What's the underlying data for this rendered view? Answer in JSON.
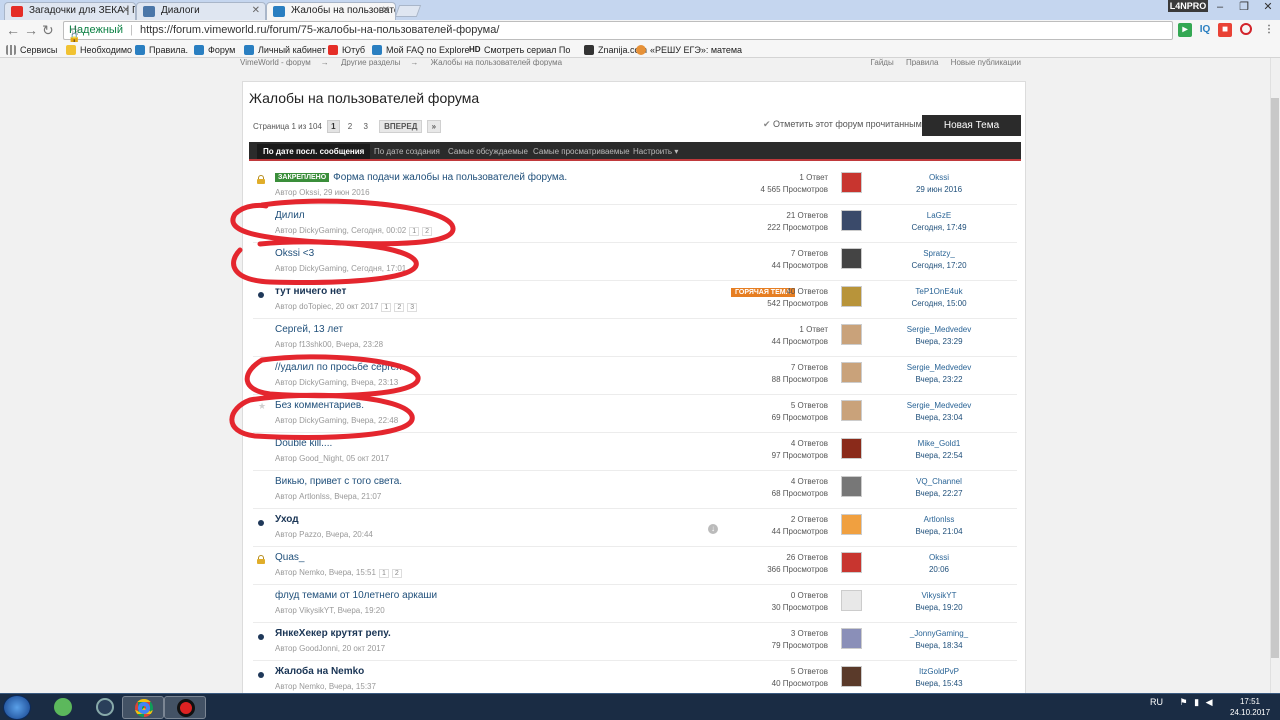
{
  "browser": {
    "tabs": [
      {
        "title": "Загадочки для ЗЕКА | П",
        "icon": "youtube-icon",
        "color": "#e52d27"
      },
      {
        "title": "Диалоги",
        "icon": "vk-icon",
        "color": "#4a76a8"
      },
      {
        "title": "Жалобы на пользовате",
        "icon": "vimeworld-icon",
        "color": "#2a7fc1",
        "active": true
      }
    ],
    "profile_badge": "L4NPRO",
    "address": {
      "secure_label": "Надежный",
      "url": "https://forum.vimeworld.ru/forum/75-жалобы-на-пользователей-форума/"
    },
    "extensions": [
      "ext-green-icon",
      "IQ",
      "ext-red-icon",
      "opera-icon"
    ],
    "bookmarks": [
      {
        "label": "Сервисы",
        "icon": "apps-icon",
        "color": "#888"
      },
      {
        "label": "Необходимо",
        "icon": "folder-icon",
        "color": "#f1c232"
      },
      {
        "label": "Правила.",
        "icon": "vimeworld-icon",
        "color": "#2a7fc1"
      },
      {
        "label": "Форум",
        "icon": "vimeworld-icon",
        "color": "#2a7fc1"
      },
      {
        "label": "Личный кабинет",
        "icon": "vimeworld-icon",
        "color": "#2a7fc1"
      },
      {
        "label": "Ютуб",
        "icon": "youtube-icon",
        "color": "#e52d27"
      },
      {
        "label": "Мой FAQ по Explore",
        "icon": "vimeworld-icon",
        "color": "#2a7fc1"
      },
      {
        "label": "Смотреть сериал По",
        "icon": "hd-icon",
        "color": "#222"
      },
      {
        "label": "Znanija.com",
        "icon": "znanija-icon",
        "color": "#333"
      },
      {
        "label": "«РЕШУ ЕГЭ»: матема",
        "icon": "reshu-ege-icon",
        "color": "#e69138"
      }
    ]
  },
  "forum": {
    "breadcrumb": [
      "VimeWorld - форум",
      "Другие разделы",
      "Жалобы на пользователей форума"
    ],
    "top_links": [
      "Гайды",
      "Правила",
      "Новые публикации"
    ],
    "title": "Жалобы на пользователей форума",
    "pager": {
      "label": "Страница 1 из 104",
      "pages": [
        "1",
        "2",
        "3"
      ],
      "next": "ВПЕРЕД",
      "next_arrow": "»"
    },
    "mark_read": "Отметить этот форум прочитанным",
    "new_topic": "Новая Тема",
    "sort_tabs": [
      "По дате посл. сообщения",
      "По дате создания",
      "Самые обсуждаемые",
      "Самые просматриваемые",
      "Настроить"
    ],
    "pinned_label": "ЗАКРЕПЛЕНО",
    "hot_label": "ГОРЯЧАЯ ТЕМА",
    "topics": [
      {
        "status": "locked",
        "pinned": true,
        "title": "Форма подачи жалобы на пользователей форума.",
        "meta": "Автор Okssi, 29 июн 2016",
        "pages": [],
        "replies": "1 Ответ",
        "views": "4 565 Просмотров",
        "last_user": "Okssi",
        "last_date": "29 июн 2016",
        "avatar_color": "#c8352f"
      },
      {
        "status": "read",
        "title": "Дилил",
        "meta": "Автор DickyGaming, Сегодня, 00:02",
        "pages": [
          "1",
          "2"
        ],
        "replies": "21 Ответов",
        "views": "222 Просмотров",
        "last_user": "LaGzE",
        "last_date": "Сегодня, 17:49",
        "avatar_color": "#3a4a6a"
      },
      {
        "status": "read",
        "title": "Okssi <3",
        "meta": "Автор DickyGaming, Сегодня, 17:01",
        "pages": [],
        "replies": "7 Ответов",
        "views": "44 Просмотров",
        "last_user": "Spratzy_",
        "last_date": "Сегодня, 17:20",
        "avatar_color": "#444"
      },
      {
        "status": "unread",
        "hot": true,
        "title": "тут ничего нет",
        "meta": "Автор doTopiec, 20 окт 2017",
        "pages": [
          "1",
          "2",
          "3"
        ],
        "replies": "40 Ответов",
        "views": "542 Просмотров",
        "last_user": "TeP1OnE4uk",
        "last_date": "Сегодня, 15:00",
        "avatar_color": "#b8943a"
      },
      {
        "status": "read",
        "title": "Сергей, 13 лет",
        "meta": "Автор f13shk00, Вчера, 23:28",
        "pages": [],
        "replies": "1 Ответ",
        "views": "44 Просмотров",
        "last_user": "Sergie_Medvedev",
        "last_date": "Вчера, 23:29",
        "avatar_color": "#c9a27a"
      },
      {
        "status": "read",
        "title": "//удалил по просьбе сергея",
        "meta": "Автор DickyGaming, Вчера, 23:13",
        "pages": [],
        "replies": "7 Ответов",
        "views": "88 Просмотров",
        "last_user": "Sergie_Medvedev",
        "last_date": "Вчера, 23:22",
        "avatar_color": "#c9a27a"
      },
      {
        "status": "star",
        "title": "Без комментариев.",
        "meta": "Автор DickyGaming, Вчера, 22:48",
        "pages": [],
        "replies": "5 Ответов",
        "views": "69 Просмотров",
        "last_user": "Sergie_Medvedev",
        "last_date": "Вчера, 23:04",
        "avatar_color": "#c9a27a"
      },
      {
        "status": "read",
        "title": "Double kill....",
        "meta": "Автор Good_Night, 05 окт 2017",
        "pages": [],
        "replies": "4 Ответов",
        "views": "97 Просмотров",
        "last_user": "Mike_Gold1",
        "last_date": "Вчера, 22:54",
        "avatar_color": "#8a2a1a"
      },
      {
        "status": "read",
        "title": "Викью, привет с того света.",
        "meta": "Автор Artlonlss, Вчера, 21:07",
        "pages": [],
        "replies": "4 Ответов",
        "views": "68 Просмотров",
        "last_user": "VQ_Channel",
        "last_date": "Вчера, 22:27",
        "avatar_color": "#777"
      },
      {
        "status": "unread",
        "download": true,
        "title": "Уход",
        "meta": "Автор Pazzo, Вчера, 20:44",
        "pages": [],
        "replies": "2 Ответов",
        "views": "44 Просмотров",
        "last_user": "Artlonlss",
        "last_date": "Вчера, 21:04",
        "avatar_color": "#f0a040"
      },
      {
        "status": "locked",
        "title": "Quas_",
        "meta": "Автор Nemko, Вчера, 15:51",
        "pages": [
          "1",
          "2"
        ],
        "replies": "26 Ответов",
        "views": "366 Просмотров",
        "last_user": "Okssi",
        "last_date": "20:06",
        "avatar_color": "#c8352f"
      },
      {
        "status": "read",
        "title": "флуд темами от 10летнего аркаши",
        "meta": "Автор VikysikYT, Вчера, 19:20",
        "pages": [],
        "replies": "0 Ответов",
        "views": "30 Просмотров",
        "last_user": "VikysikYT",
        "last_date": "Вчера, 19:20",
        "avatar_color": "#e8e8e8"
      },
      {
        "status": "unread",
        "title": "ЯнкеХекер крутят репу.",
        "meta": "Автор GoodJonni, 20 окт 2017",
        "pages": [],
        "replies": "3 Ответов",
        "views": "79 Просмотров",
        "last_user": "_JonnyGaming_",
        "last_date": "Вчера, 18:34",
        "avatar_color": "#8a8fb8"
      },
      {
        "status": "unread",
        "title": "Жалоба на Nemko",
        "meta": "Автор Nemko, Вчера, 15:37",
        "pages": [],
        "replies": "5 Ответов",
        "views": "40 Просмотров",
        "last_user": "ItzGoldPvP",
        "last_date": "Вчера, 15:43",
        "avatar_color": "#5a3a2a"
      }
    ]
  },
  "taskbar": {
    "apps": [
      "utorrent-icon",
      "steam-icon",
      "chrome-icon",
      "recorder-icon"
    ],
    "lang": "RU",
    "time": "17:51",
    "date": "24.10.2017"
  }
}
